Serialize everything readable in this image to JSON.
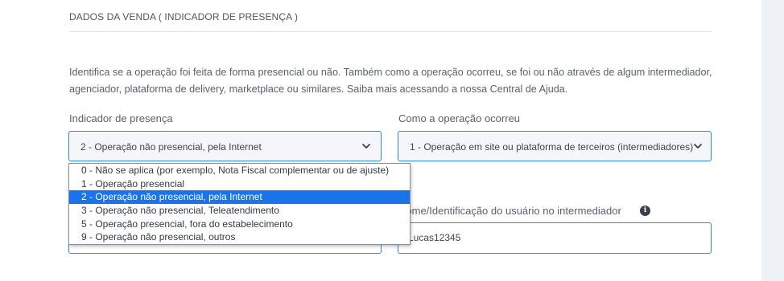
{
  "section": {
    "title": "DADOS DA VENDA ( INDICADOR DE PRESENÇA )",
    "description": "Identifica se a operação foi feita de forma presencial ou não. Também como a operação ocorreu, se foi ou não através de algum intermediador, agenciador, plataforma de delivery, marketplace ou similares. Saiba mais acessando a nossa Central de Ajuda."
  },
  "presence": {
    "label": "Indicador de presença",
    "selected": "2 - Operação não presencial, pela Internet",
    "options": [
      "0 - Não se aplica (por exemplo, Nota Fiscal complementar ou de ajuste)",
      "1 - Operação presencial",
      "2 - Operação não presencial, pela Internet",
      "3 - Operação não presencial, Teleatendimento",
      "5 - Operação presencial, fora do estabelecimento",
      "9 - Operação não presencial, outros"
    ],
    "selected_index": 2
  },
  "operation": {
    "label": "Como a operação ocorreu",
    "selected": "1 - Operação em site ou plataforma de terceiros (intermediadores)"
  },
  "intermediary_user": {
    "label": "Nome/Identificação do usuário no intermediador",
    "value": "Lucas12345",
    "info_icon": "i"
  },
  "colors": {
    "accent": "#2a8cd6",
    "selected_option": "#1a73e8"
  }
}
